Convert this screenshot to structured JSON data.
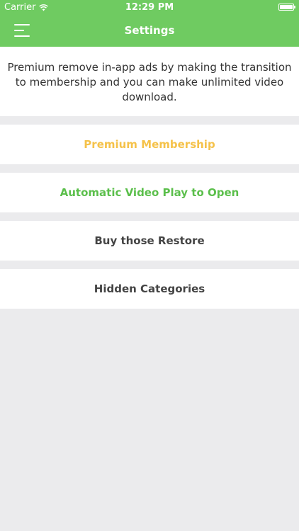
{
  "status_bar": {
    "carrier": "Carrier",
    "time": "12:29 PM"
  },
  "nav": {
    "title": "Settings"
  },
  "info_text": "Premium remove in-app ads by making the transition to membership and you can make unlimited video download.",
  "rows": [
    {
      "label": "Premium Membership",
      "color": "#f5c24a"
    },
    {
      "label": "Automatic Video Play to Open",
      "color": "#5bbf4b"
    },
    {
      "label": "Buy those Restore",
      "color": "#444444"
    },
    {
      "label": "Hidden Categories",
      "color": "#444444"
    }
  ],
  "colors": {
    "accent": "#6fcb61",
    "background": "#ebebed"
  }
}
